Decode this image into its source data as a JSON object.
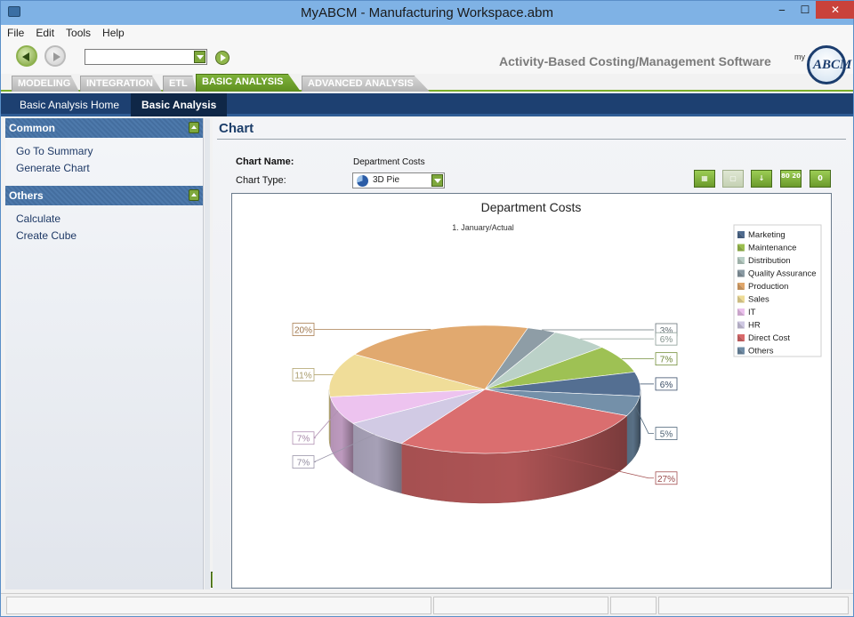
{
  "window": {
    "title": "MyABCM  - Manufacturing Workspace.abm",
    "min": "‒",
    "max": "☐",
    "close": "✕"
  },
  "menu": [
    "File",
    "Edit",
    "Tools",
    "Help"
  ],
  "toolbar": {
    "tagline": "Activity-Based Costing/Management Software",
    "logo_prefix": "my",
    "logo_text": "ABCM",
    "combo_value": ""
  },
  "tabs": [
    {
      "label": "MODELING",
      "active": false
    },
    {
      "label": "INTEGRATION",
      "active": false
    },
    {
      "label": "ETL",
      "active": false
    },
    {
      "label": "BASIC ANALYSIS",
      "active": true
    },
    {
      "label": "ADVANCED ANALYSIS",
      "active": false
    }
  ],
  "subnav": [
    {
      "label": "Basic Analysis Home",
      "active": false
    },
    {
      "label": "Basic Analysis",
      "active": true
    }
  ],
  "sidebar": {
    "common": {
      "title": "Common",
      "items": [
        "Go To Summary",
        "Generate Chart"
      ]
    },
    "others": {
      "title": "Others",
      "items": [
        "Calculate",
        "Create Cube"
      ]
    },
    "expand": ">>"
  },
  "main": {
    "title": "Chart",
    "chart_name_label": "Chart Name:",
    "chart_name_value": "Department Costs",
    "chart_type_label": "Chart Type:",
    "chart_type_value": "3D Pie",
    "tools": [
      {
        "name": "data-grid-button",
        "text": "▦",
        "enabled": true
      },
      {
        "name": "view-toggle-button",
        "text": "▢",
        "enabled": false
      },
      {
        "name": "sort-button",
        "text": "↓",
        "enabled": true
      },
      {
        "name": "precision-button",
        "text": "80 20",
        "enabled": true
      },
      {
        "name": "zero-button",
        "text": "0",
        "enabled": true
      }
    ]
  },
  "chart_data": {
    "type": "pie",
    "title": "Department Costs",
    "subtitle": "1. January/Actual",
    "labels": [
      "Marketing",
      "Maintenance",
      "Distribution",
      "Quality Assurance",
      "Production",
      "Sales",
      "IT",
      "HR",
      "Direct Cost",
      "Others"
    ],
    "values": [
      6,
      7,
      6,
      3,
      20,
      11,
      7,
      7,
      27,
      5
    ],
    "value_labels": [
      "6%",
      "7%",
      "6%",
      "3%",
      "20%",
      "11%",
      "7%",
      "7%",
      "27%",
      "5%"
    ],
    "colors": [
      "#4e6a8e",
      "#9bbf4e",
      "#b9cfc6",
      "#8a9aa3",
      "#e0a66a",
      "#efdc96",
      "#ecc1ee",
      "#cfc8e3",
      "#d9696a",
      "#6f8ca6"
    ],
    "legend_position": "top-right",
    "style": "3d"
  }
}
